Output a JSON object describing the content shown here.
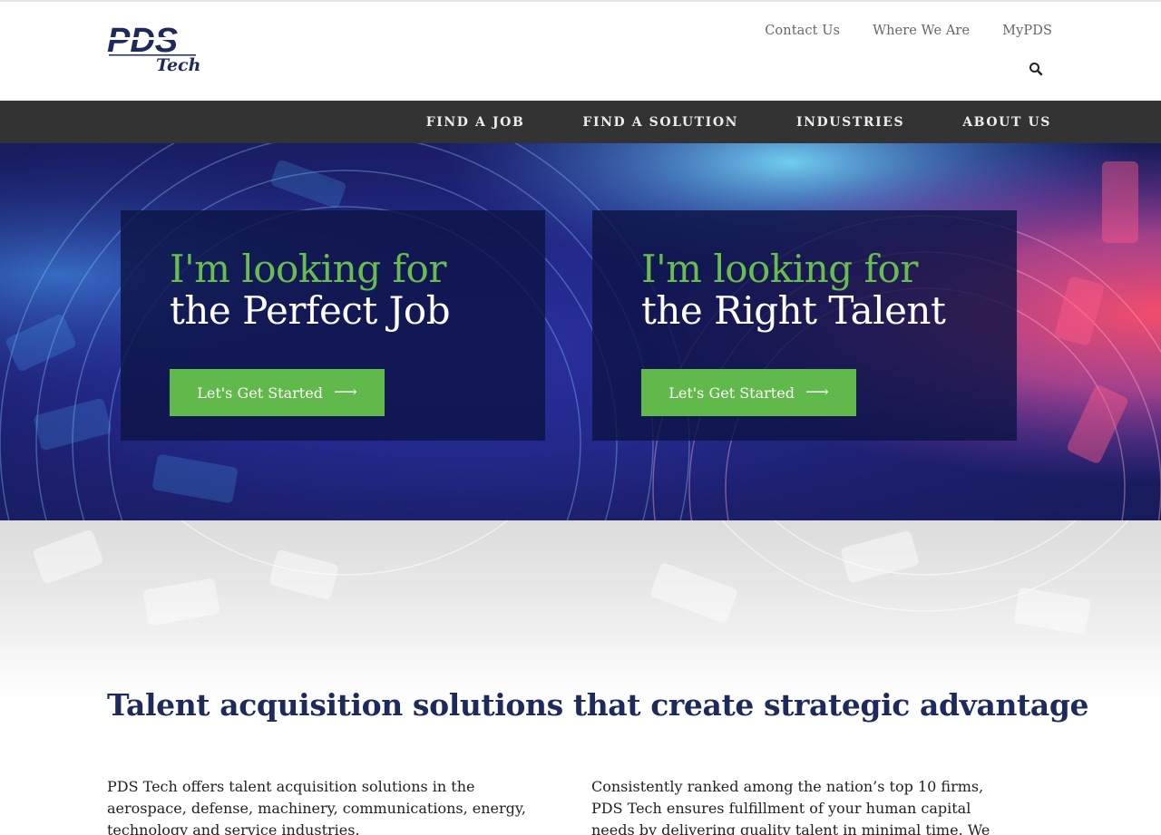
{
  "brand": {
    "logo_main": "PDS",
    "logo_sub": "Tech",
    "primary_color": "#1f2a5c",
    "accent_color": "#62b94b",
    "nav_bg": "#333333"
  },
  "utility_nav": {
    "items": [
      "Contact Us",
      "Where We Are",
      "MyPDS"
    ],
    "search_icon": "search-icon"
  },
  "main_nav": {
    "items": [
      "FIND A JOB",
      "FIND A SOLUTION",
      "INDUSTRIES",
      "ABOUT US"
    ]
  },
  "hero": {
    "cards": [
      {
        "line1": "I'm looking for",
        "line2": "the Perfect Job",
        "button": "Let's Get Started",
        "button_icon": "arrow-right-icon"
      },
      {
        "line1": "I'm looking for",
        "line2": "the Right Talent",
        "button": "Let's Get Started",
        "button_icon": "arrow-right-icon"
      }
    ]
  },
  "content": {
    "headline": "Talent acquisition solutions that create strategic advantage",
    "col_left": "PDS Tech offers talent acquisition solutions in the aerospace, defense, machinery, communications, energy, technology and service industries.",
    "col_right": "Consistently ranked among the nation’s top 10 firms, PDS Tech ensures fulfillment of your human capital needs by delivering quality talent in minimal time. We also have one"
  }
}
